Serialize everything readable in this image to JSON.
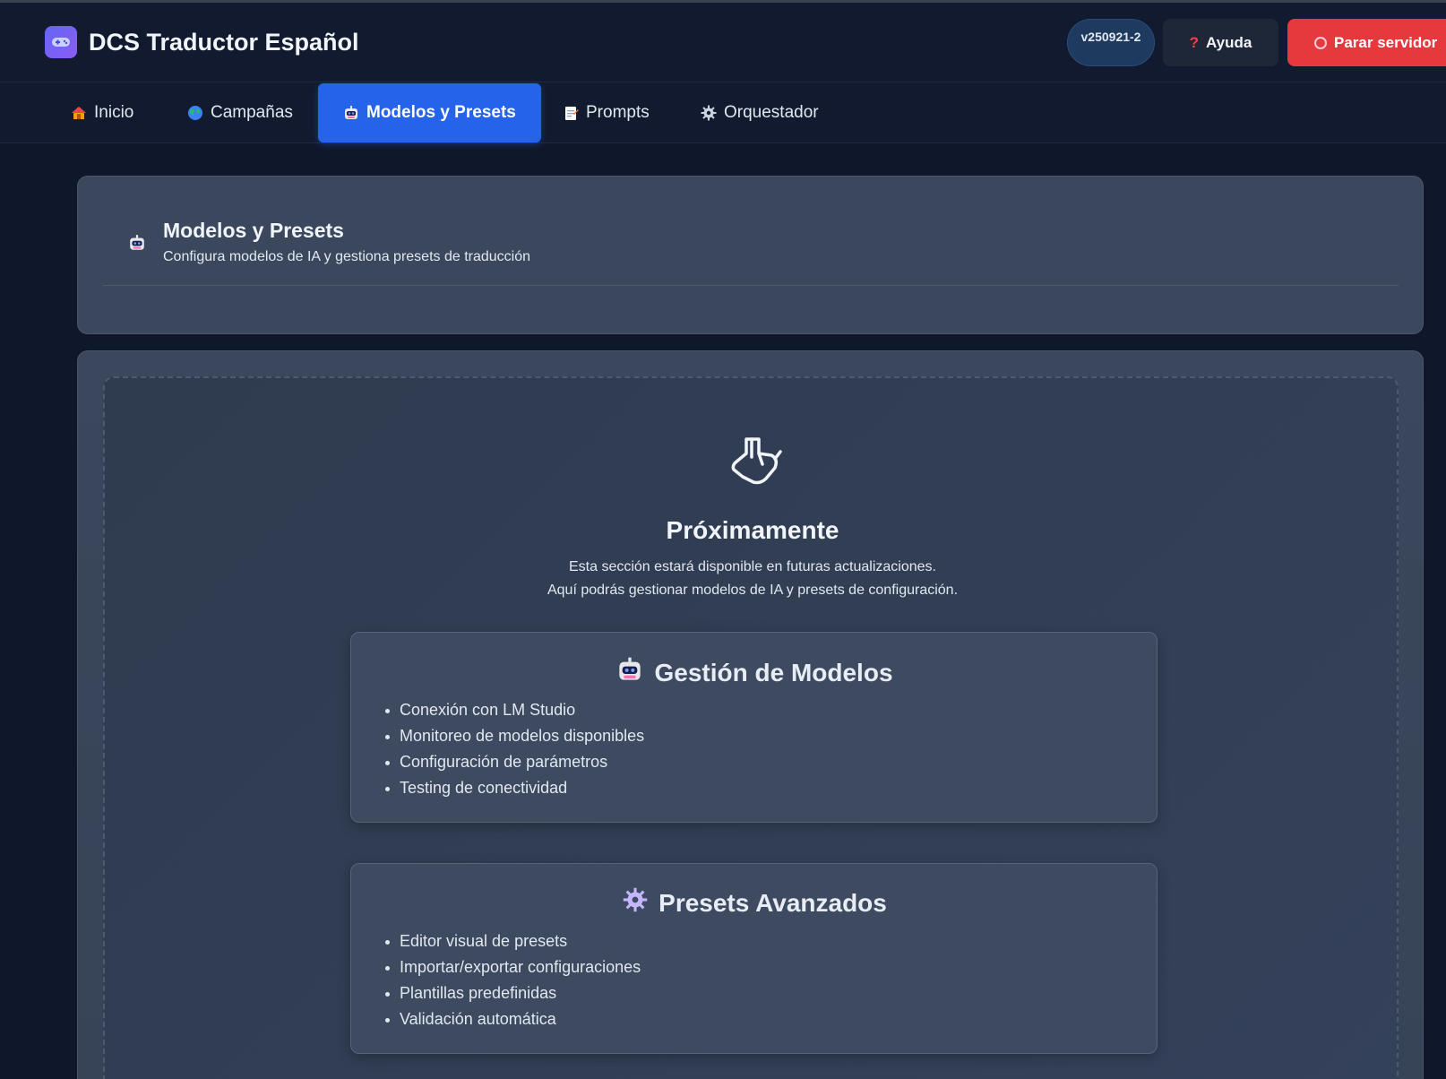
{
  "app": {
    "title": "DCS Traductor Español",
    "version": "v250921-2"
  },
  "header": {
    "help_label": "Ayuda",
    "stop_label": "Parar servidor"
  },
  "nav": {
    "tabs": [
      {
        "label": "Inicio",
        "icon": "house-icon"
      },
      {
        "label": "Campañas",
        "icon": "globe-icon"
      },
      {
        "label": "Modelos y Presets",
        "icon": "robot-icon",
        "active": true
      },
      {
        "label": "Prompts",
        "icon": "memo-icon"
      },
      {
        "label": "Orquestador",
        "icon": "gear-icon"
      }
    ]
  },
  "section_header": {
    "title": "Modelos y Presets",
    "subtitle": "Configura modelos de IA y gestiona presets de traducción"
  },
  "coming_soon": {
    "title": "Próximamente",
    "line1": "Esta sección estará disponible en futuras actualizaciones.",
    "line2": "Aquí podrás gestionar modelos de IA y presets de configuración."
  },
  "features": [
    {
      "title": "Gestión de Modelos",
      "icon": "robot-icon",
      "items": [
        "Conexión con LM Studio",
        "Monitoreo de modelos disponibles",
        "Configuración de parámetros",
        "Testing de conectividad"
      ]
    },
    {
      "title": "Presets Avanzados",
      "icon": "gear-icon",
      "items": [
        "Editor visual de presets",
        "Importar/exportar configuraciones",
        "Plantillas predefinidas",
        "Validación automática"
      ]
    }
  ],
  "colors": {
    "accent": "#2563eb",
    "danger": "#e5393e",
    "background": "#0f172a"
  }
}
